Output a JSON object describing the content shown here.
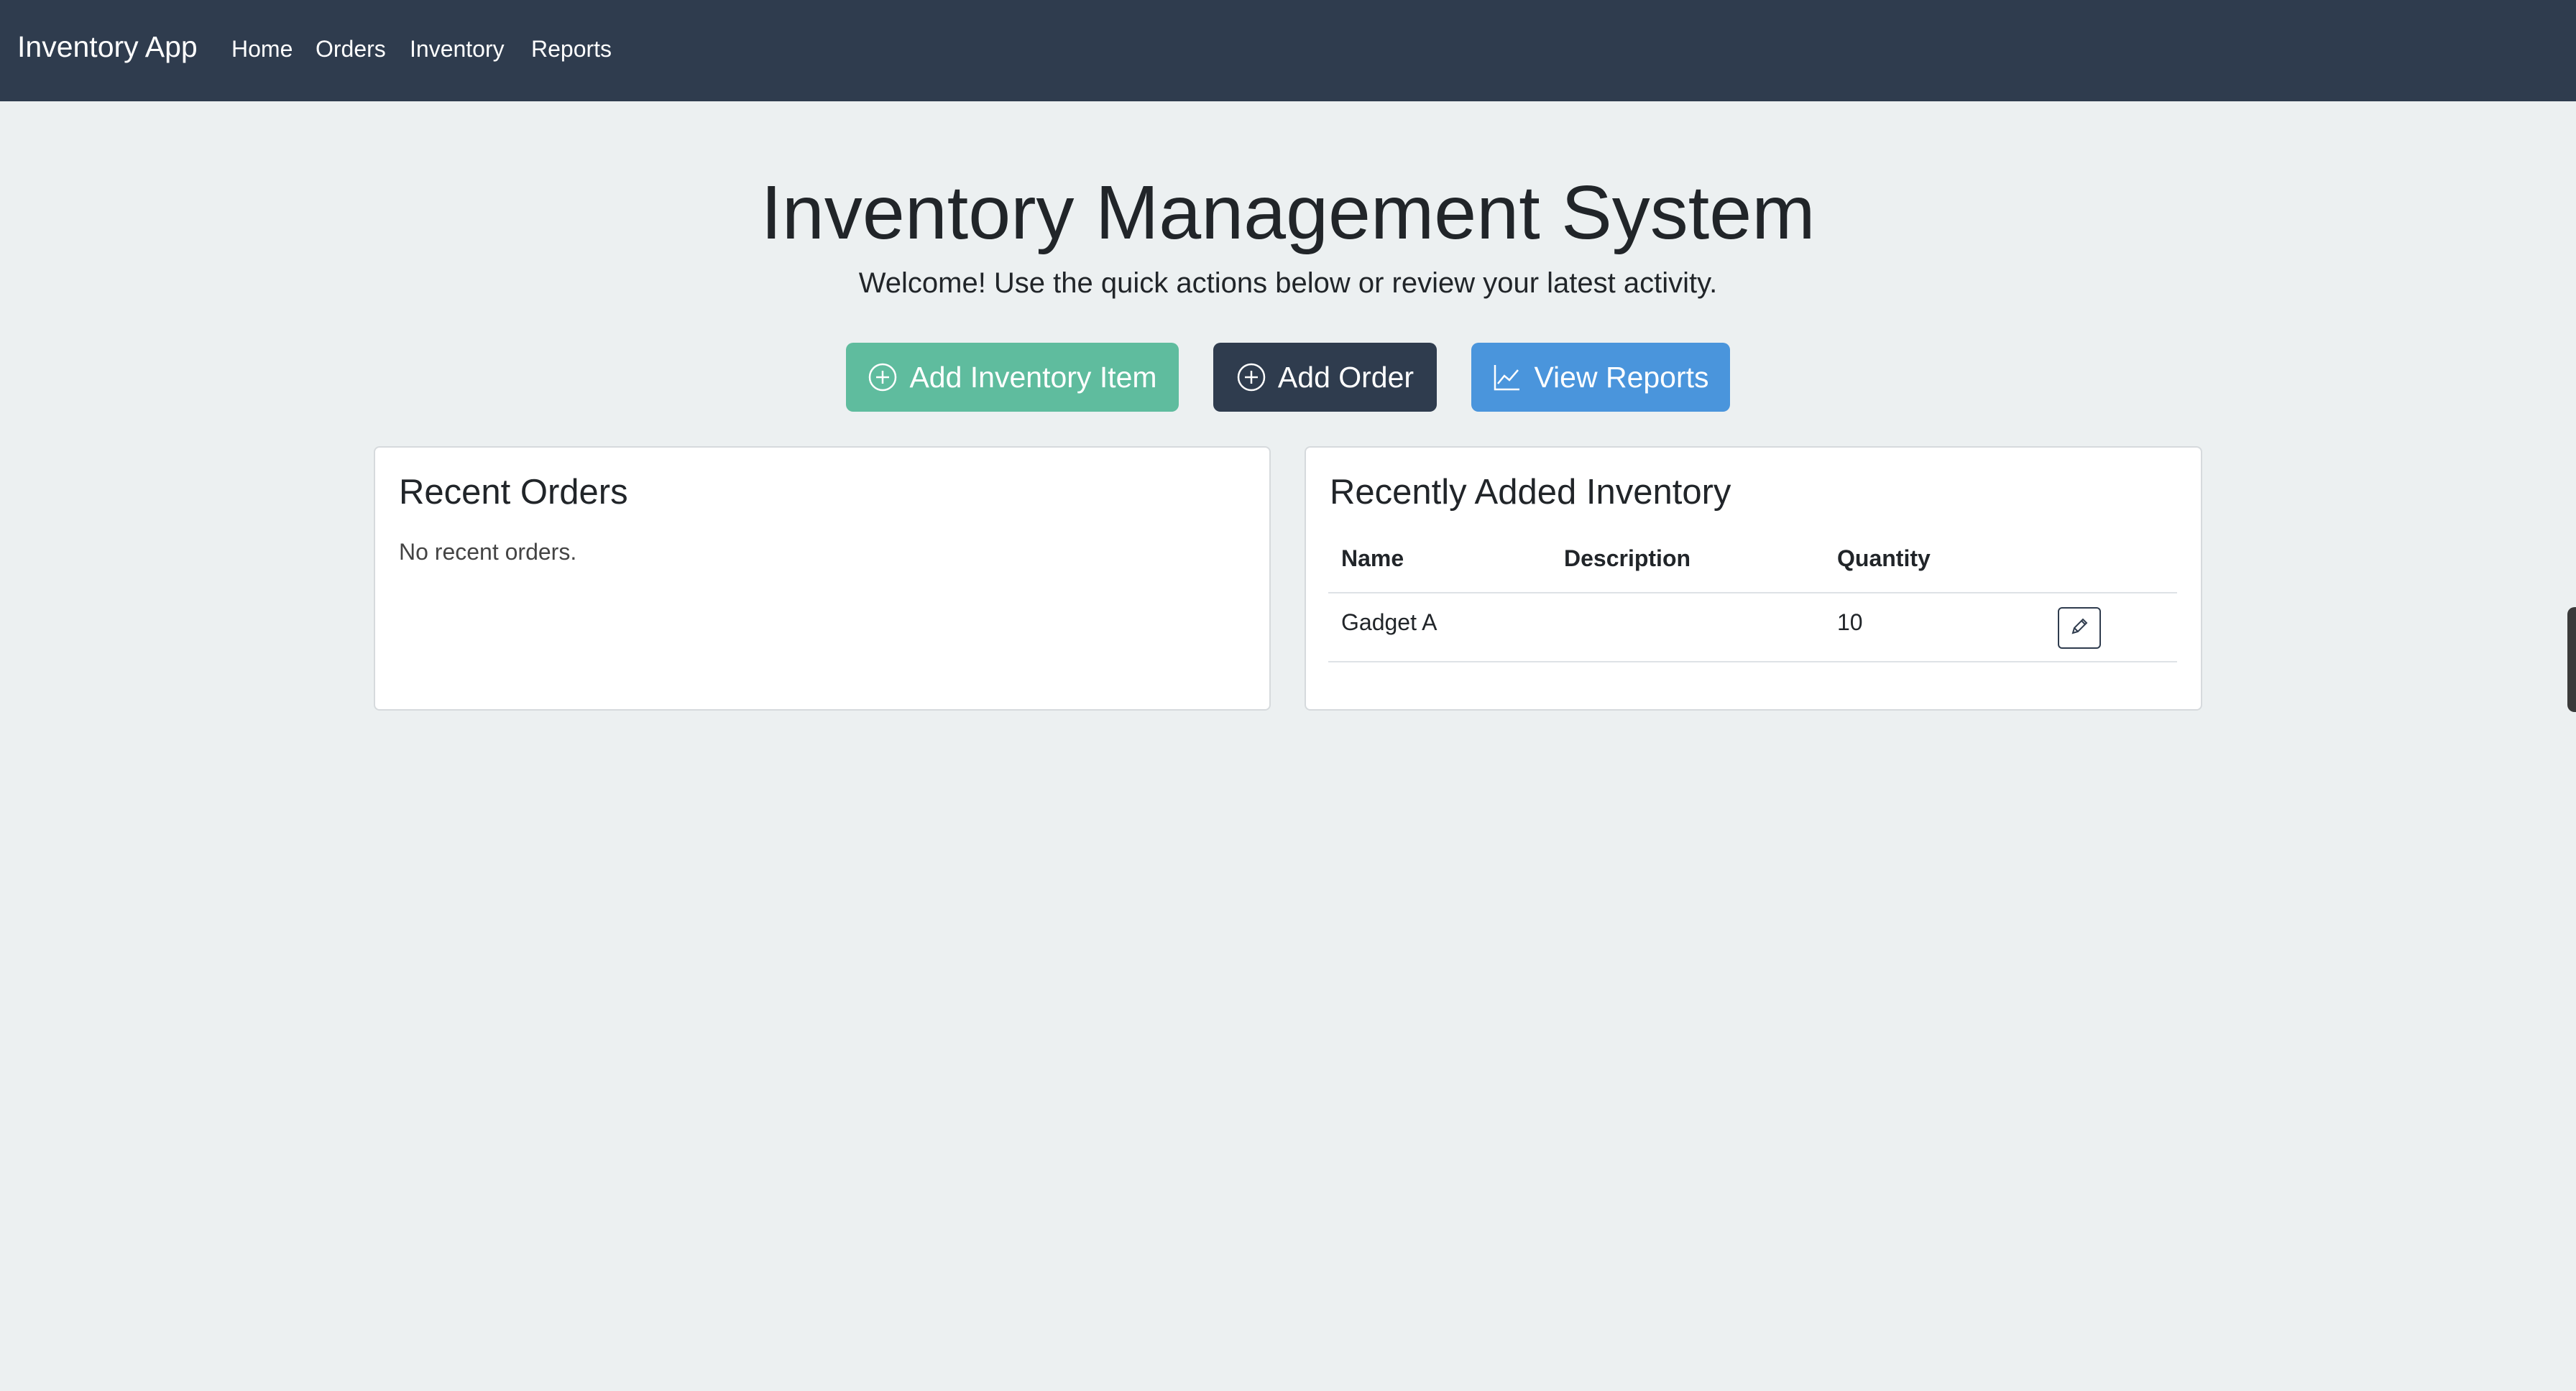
{
  "navbar": {
    "brand": "Inventory App",
    "links": [
      {
        "label": "Home"
      },
      {
        "label": "Orders"
      },
      {
        "label": "Inventory"
      },
      {
        "label": "Reports"
      }
    ],
    "background": "#2f3c4e"
  },
  "hero": {
    "title": "Inventory Management System",
    "subtitle": "Welcome! Use the quick actions below or review your latest activity."
  },
  "actions": {
    "add_inventory": {
      "label": "Add Inventory Item",
      "icon": "plus-circle-icon",
      "color": "#5fbc9e"
    },
    "add_order": {
      "label": "Add Order",
      "icon": "plus-circle-icon",
      "color": "#2f3c4e"
    },
    "view_reports": {
      "label": "View Reports",
      "icon": "line-chart-icon",
      "color": "#4a95dc"
    }
  },
  "recent_orders": {
    "title": "Recent Orders",
    "empty_message": "No recent orders."
  },
  "recent_inventory": {
    "title": "Recently Added Inventory",
    "columns": [
      "Name",
      "Description",
      "Quantity"
    ],
    "rows": [
      {
        "name": "Gadget A",
        "description": "",
        "quantity": "10",
        "action_icon": "pencil-icon"
      }
    ]
  }
}
